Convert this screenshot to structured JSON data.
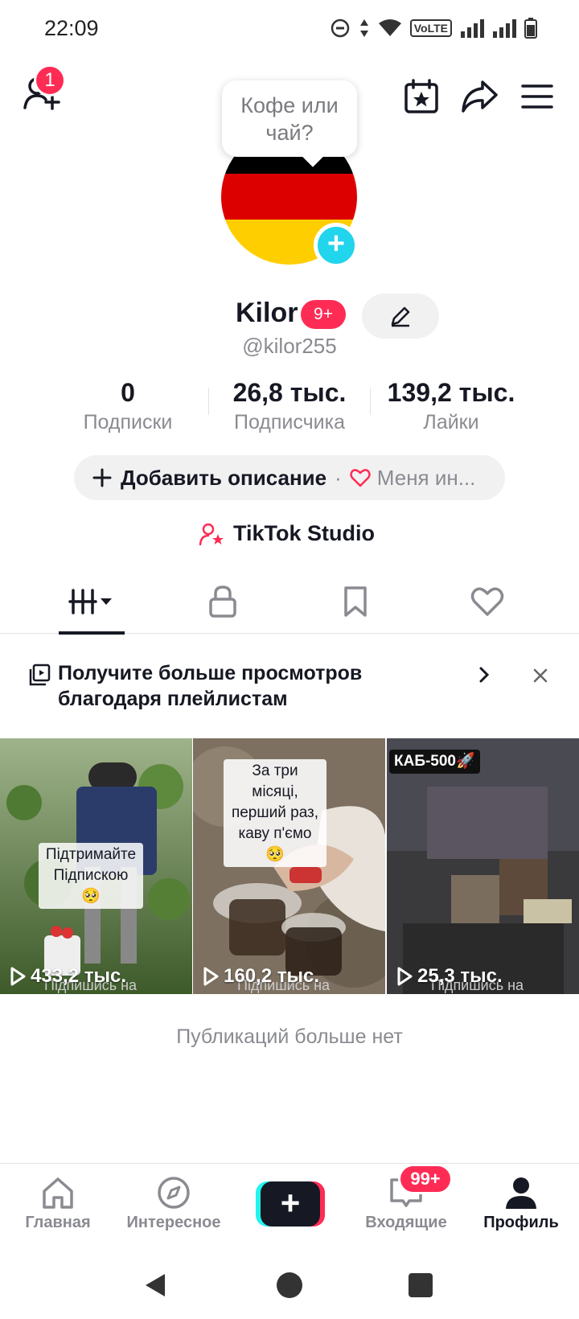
{
  "status_bar": {
    "time": "22:09",
    "network_label": "VoLTE"
  },
  "header": {
    "friends_badge": "1",
    "question_bubble": "Кофе или чай?"
  },
  "profile": {
    "name": "Kilor",
    "name_badge": "9+",
    "handle": "@kilor255",
    "avatar_colors": [
      "#000000",
      "#dd0000",
      "#ffce00"
    ]
  },
  "stats": [
    {
      "value": "0",
      "label": "Подписки"
    },
    {
      "value": "26,8 тыс.",
      "label": "Подписчика"
    },
    {
      "value": "139,2 тыс.",
      "label": "Лайки"
    }
  ],
  "description": {
    "add_label": "Добавить описание",
    "interest_label": "Меня ин..."
  },
  "studio": {
    "label": "TikTok Studio"
  },
  "tabs": [
    "videos-grid-icon",
    "lock-icon",
    "bookmark-icon",
    "heart-icon"
  ],
  "promo": {
    "text": "Получите больше просмотров благодаря плейлистам"
  },
  "videos": [
    {
      "overlay": "Підтримайте Підпискою 🥺",
      "views": "433,2 тыс.",
      "subtitle": "Підпишись на"
    },
    {
      "overlay": "За три місяці, перший раз, каву п'ємо 🥺",
      "views": "160,2 тыс.",
      "subtitle": "Підпишись на"
    },
    {
      "overlay": "КАБ-500🚀",
      "views": "25,3 тыс.",
      "subtitle": "Підпишись на"
    }
  ],
  "no_more": "Публикаций больше нет",
  "bottom_nav": {
    "home": "Главная",
    "explore": "Интересное",
    "inbox": "Входящие",
    "inbox_badge": "99+",
    "profile": "Профиль"
  },
  "colors": {
    "accent": "#fe2c55",
    "cyan": "#25f4ee",
    "text": "#161823",
    "muted": "#8a8b91"
  }
}
